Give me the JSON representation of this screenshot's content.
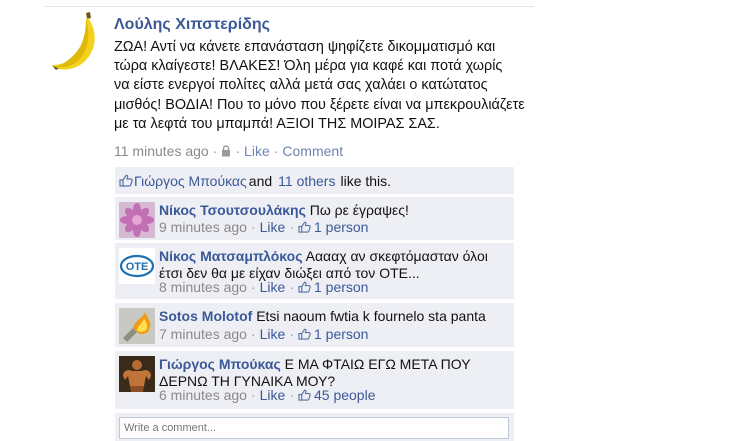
{
  "post": {
    "author": "Λούλης Χιπστερίδης",
    "text_lines": [
      "ΖΩΑ! Αντί να κάνετε επανάσταση ψηφίζετε δικομματισμό και",
      "τώρα κλαίγεστε! ΒΛΑΚΕΣ! Όλη μέρα για καφέ και ποτά χωρίς",
      "να είστε ενεργοί πολίτες αλλά μετά σας χαλάει ο κατώτατος",
      "μισθός! ΒΟΔΙΑ! Που το μόνο που ξέρετε είναι να μπεκρουλιάζετε",
      "με τα λεφτά του μπαμπά! ΑΞΙΟΙ ΤΗΣ ΜΟΙΡΑΣ ΣΑΣ."
    ],
    "time": "11 minutes ago",
    "sep": "·",
    "like_label": "Like",
    "comment_label": "Comment",
    "avatar_icon": "banana-icon",
    "privacy_icon": "lock-icon"
  },
  "likes": {
    "first_name": "Γιώργος Μπούκας",
    "and": "and",
    "others": "11 others",
    "suffix": "like this."
  },
  "comments": [
    {
      "author": "Νίκος Τσουτσουλάκης",
      "text": "Πω ρε έγραψες!",
      "time": "9 minutes ago",
      "like_label": "Like",
      "likes": "1 person",
      "avatar_icon": "pink-flower-icon"
    },
    {
      "author": "Νίκος Ματσαμπλόκος",
      "text": "Ααααχ αν σκεφτόμασταν όλοι έτσι δεν θα με είχαν διώξει από τον ΟΤΕ...",
      "time": "8 minutes ago",
      "like_label": "Like",
      "likes": "1 person",
      "avatar_icon": "ote-logo-icon",
      "logo_text": "ΟΤΕ"
    },
    {
      "author": "Sotos Molotof",
      "text": "Etsi naoum fwtia k fournelo sta panta",
      "time": "7 minutes ago",
      "like_label": "Like",
      "likes": "1 person",
      "avatar_icon": "molotov-fire-icon"
    },
    {
      "author": "Γιώργος Μπούκας",
      "text": "Ε ΜΑ ΦΤΑΙΩ ΕΓΩ ΜΕΤΑ ΠΟΥ ΔΕΡΝΩ ΤΗ ΓΥΝΑΙΚΑ ΜΟΥ?",
      "time": "6 minutes ago",
      "like_label": "Like",
      "likes": "45 people",
      "avatar_icon": "bodybuilder-icon"
    }
  ],
  "write_comment": {
    "placeholder": "Write a comment..."
  },
  "colors": {
    "link_blue": "#3b5998",
    "meta_grey": "#8a8a8a",
    "comment_bg": "#edeff4"
  }
}
